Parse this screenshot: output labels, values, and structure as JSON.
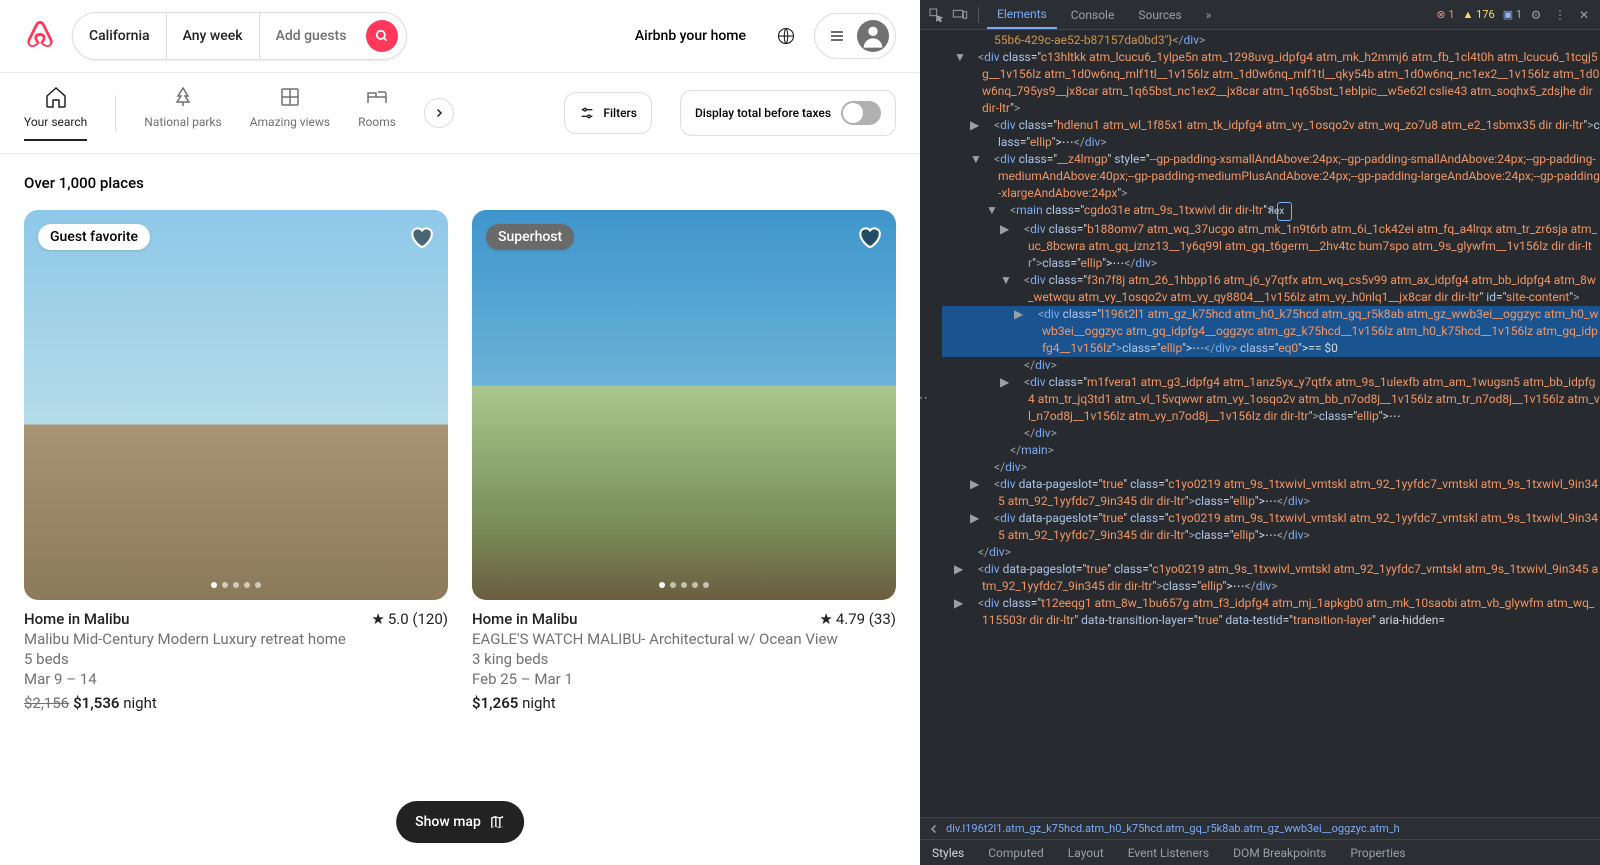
{
  "header": {
    "search": {
      "location": "California",
      "dates": "Any week",
      "guests": "Add guests"
    },
    "host_link": "Airbnb your home"
  },
  "categories": {
    "items": [
      {
        "label": "Your search",
        "active": true
      },
      {
        "label": "National parks"
      },
      {
        "label": "Amazing views"
      },
      {
        "label": "Rooms"
      }
    ],
    "filters_label": "Filters",
    "tax_label": "Display total before taxes"
  },
  "results": {
    "heading": "Over 1,000 places",
    "cards": [
      {
        "badge": "Guest favorite",
        "badge_style": "light",
        "title": "Home in Malibu",
        "rating": "5.0 (120)",
        "subtitle": "Malibu Mid-Century Modern Luxury retreat home",
        "beds": "5 beds",
        "dates": "Mar 9 – 14",
        "price_strike": "$2,156",
        "price": "$1,536",
        "price_unit": "night"
      },
      {
        "badge": "Superhost",
        "badge_style": "dark",
        "title": "Home in Malibu",
        "rating": "4.79 (33)",
        "subtitle": "EAGLE'S WATCH MALIBU- Architectural w/ Ocean View",
        "beds": "3 king beds",
        "dates": "Feb 25 – Mar 1",
        "price": "$1,265",
        "price_unit": "night"
      }
    ],
    "map_button": "Show map"
  },
  "devtools": {
    "tabs": [
      "Elements",
      "Console",
      "Sources"
    ],
    "more": "»",
    "errors": "1",
    "warnings": "176",
    "info": "1",
    "bottom_tabs": [
      "Styles",
      "Computed",
      "Layout",
      "Event Listeners",
      "DOM Breakpoints",
      "Properties"
    ],
    "breadcrumb": "div.l196t2l1.atm_gz_k75hcd.atm_h0_k75hcd.atm_gq_r5k8ab.atm_gz_wwb3ei__oggzyc.atm_h",
    "tree": [
      {
        "ind": 56,
        "html": "55b6-429c-ae52-b87157da0bd3\"}</div>"
      },
      {
        "ind": 40,
        "arrow": "▼",
        "html": "<div class=\"c13hltkk atm_lcucu6_1ylpe5n atm_1298uvg_idpfg4 atm_mk_h2mmj6 atm_fb_1cl4t0h atm_lcucu6_1tcgj5g__1v156lz atm_1d0w6nq_mlf1tl__1v156lz atm_1d0w6nq_mlf1tl__qky54b atm_1d0w6nq_nc1ex2__1v156lz atm_1d0w6nq_795ys9__jx8car atm_1q65bst_nc1ex2__jx8car atm_1q65bst_1eblpic__w5e62l cslie43 atm_soqhx5_zdsjhe dir dir-ltr\">"
      },
      {
        "ind": 56,
        "arrow": "▶",
        "html": "<div class=\"hdlenu1 atm_wl_1f85x1 atm_tk_idpfg4 atm_vy_1osqo2v atm_wq_zo7u8 atm_e2_1sbmx35 dir dir-ltr\">…</div>"
      },
      {
        "ind": 56,
        "arrow": "▼",
        "html": "<div class=\"__z4lmgp\" style=\"--gp-padding-xsmallAndAbove:24px;--gp-padding-smallAndAbove:24px;--gp-padding-mediumAndAbove:40px;--gp-padding-mediumPlusAndAbove:24px;--gp-padding-largeAndAbove:24px;--gp-padding-xlargeAndAbove:24px\">"
      },
      {
        "ind": 72,
        "arrow": "▼",
        "html": "<main class=\"cgdo31e atm_9s_1txwivl dir dir-ltr\">",
        "flex": true
      },
      {
        "ind": 86,
        "arrow": "▶",
        "html": "<div class=\"b188omv7 atm_wq_37ucgo atm_mk_1n9t6rb atm_6i_1ck42ei atm_fq_a4lrqx atm_tr_zr6sja atm_uc_8bcwra atm_gq_iznz13__1y6q99l atm_gq_t6germ__2hv4tc bum7spo atm_9s_glywfm__1v156lz dir dir-ltr\">…</div>"
      },
      {
        "ind": 86,
        "arrow": "▼",
        "html": "<div class=\"f3n7f8j atm_26_1hbpp16 atm_j6_y7qtfx atm_wq_cs5v99 atm_ax_idpfg4 atm_bb_idpfg4 atm_8w_wetwqu atm_vy_1osqo2v atm_vy_qy8804__1v156lz atm_vy_h0nlq1__jx8car dir dir-ltr\" id=\"site-content\">"
      },
      {
        "ind": 100,
        "arrow": "▶",
        "sel": true,
        "html": "<div class=\"l196t2l1 atm_gz_k75hcd atm_h0_k75hcd atm_gq_r5k8ab atm_gz_wwb3ei__oggzyc atm_h0_wwb3ei__oggzyc atm_gq_idpfg4__oggzyc atm_gz_k75hcd__1v156lz atm_h0_k75hcd__1v156lz atm_gq_idpfg4__1v156lz\">…</div> == $0"
      },
      {
        "ind": 86,
        "html": "</div>"
      },
      {
        "ind": 86,
        "arrow": "▶",
        "html": "<div class=\"m1fvera1 atm_g3_idpfg4 atm_1anz5yx_y7qtfx atm_9s_1ulexfb atm_am_1wugsn5 atm_bb_idpfg4 atm_tr_jq3td1 atm_vl_15vqwwr atm_vy_1osqo2v atm_bb_n7od8j__1v156lz atm_tr_n7od8j__1v156lz atm_vl_n7od8j__1v156lz atm_vy_n7od8j__1v156lz dir dir-ltr\">…"
      },
      {
        "ind": 86,
        "html": "</div>"
      },
      {
        "ind": 72,
        "html": "</main>"
      },
      {
        "ind": 56,
        "html": "</div>"
      },
      {
        "ind": 56,
        "arrow": "▶",
        "html": "<div data-pageslot=\"true\" class=\"c1yo0219 atm_9s_1txwivl_vmtskl atm_92_1yyfdc7_vmtskl atm_9s_1txwivl_9in345 atm_92_1yyfdc7_9in345 dir dir-ltr\">…</div>"
      },
      {
        "ind": 56,
        "arrow": "▶",
        "html": "<div data-pageslot=\"true\" class=\"c1yo0219 atm_9s_1txwivl_vmtskl atm_92_1yyfdc7_vmtskl atm_9s_1txwivl_9in345 atm_92_1yyfdc7_9in345 dir dir-ltr\">…</div>"
      },
      {
        "ind": 40,
        "html": "</div>"
      },
      {
        "ind": 40,
        "arrow": "▶",
        "html": "<div data-pageslot=\"true\" class=\"c1yo0219 atm_9s_1txwivl_vmtskl atm_92_1yyfdc7_vmtskl atm_9s_1txwivl_9in345 atm_92_1yyfdc7_9in345 dir dir-ltr\">…</div>"
      },
      {
        "ind": 40,
        "arrow": "▶",
        "html": "<div class=\"t12eeqg1 atm_8w_1bu657g atm_f3_idpfg4 atm_mj_1apkgb0 atm_mk_10saobi atm_vb_glywfm atm_wq_115503r dir dir-ltr\" data-transition-layer=\"true\" data-testid=\"transition-layer\" aria-hidden="
      }
    ]
  }
}
